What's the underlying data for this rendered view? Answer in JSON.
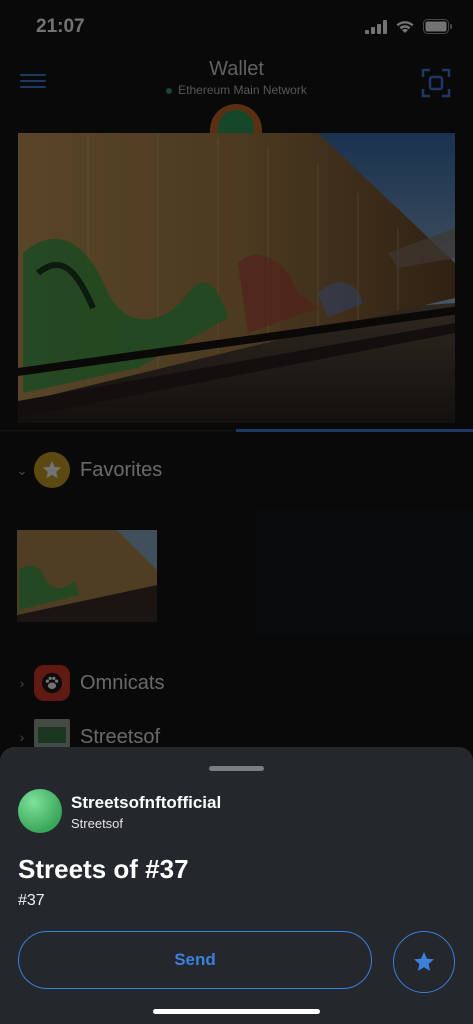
{
  "status_bar": {
    "time": "21:07"
  },
  "header": {
    "title": "Wallet",
    "network": "Ethereum Main Network",
    "menu_icon": "hamburger-icon",
    "scan_icon": "scan-icon"
  },
  "collections": [
    {
      "label": "Favorites",
      "icon": "star-icon",
      "expanded": true
    },
    {
      "label": "Omnicats",
      "icon": "paw-icon",
      "expanded": false
    },
    {
      "label": "Streetsof",
      "icon": "thumbnail",
      "expanded": false
    }
  ],
  "sheet": {
    "collection_name": "Streetsofnftofficial",
    "collection_short": "Streetsof",
    "nft_title": "Streets of #37",
    "nft_id": "#37",
    "send_label": "Send",
    "favorite_icon": "star-icon"
  },
  "colors": {
    "accent": "#3c7fdc",
    "background": "#141618",
    "sheet_bg": "#24272b",
    "favorites_badge": "#c9a227",
    "omnicats_badge": "#d43a2c"
  }
}
